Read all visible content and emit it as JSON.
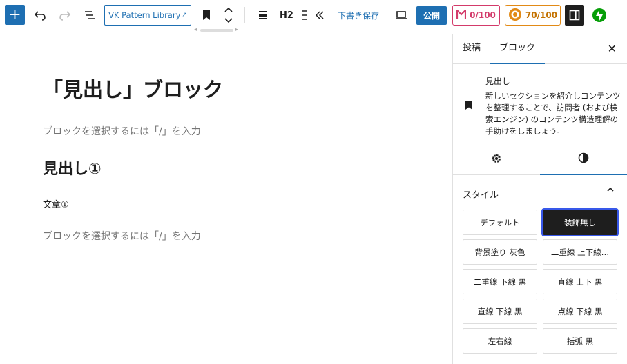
{
  "toolbar": {
    "vk_label": "VK Pattern Library",
    "heading_level": "H2",
    "draft_label": "下書き保存",
    "publish_label": "公開",
    "score_red": "0/100",
    "score_orange": "70/100"
  },
  "editor": {
    "title": "「見出し」ブロック",
    "placeholder_1": "ブロックを選択するには「/」を入力",
    "heading": "見出し①",
    "paragraph": "文章①",
    "placeholder_2": "ブロックを選択するには「/」を入力"
  },
  "sidebar": {
    "tabs": [
      "投稿",
      "ブロック"
    ],
    "block_title": "見出し",
    "block_description": "新しいセクションを紹介しコンテンツを整理することで、訪問者 (および検索エンジン) のコンテンツ構造理解の手助けをしましょう。",
    "style_label": "スタイル",
    "styles": [
      {
        "label": "デフォルト",
        "selected": false
      },
      {
        "label": "装飾無し",
        "selected": true
      },
      {
        "label": "背景塗り 灰色",
        "selected": false
      },
      {
        "label": "二重線 上下線…",
        "selected": false
      },
      {
        "label": "二重線 下線 黒",
        "selected": false
      },
      {
        "label": "直線 上下 黒",
        "selected": false
      },
      {
        "label": "直線 下線 黒",
        "selected": false
      },
      {
        "label": "点線 下線 黒",
        "selected": false
      },
      {
        "label": "左右線",
        "selected": false
      },
      {
        "label": "括弧 黒",
        "selected": false
      }
    ]
  },
  "colors": {
    "accent": "#1e6fb2",
    "score_red": "#d33a6a",
    "score_orange": "#e28a16",
    "dark": "#1e1e1e"
  }
}
